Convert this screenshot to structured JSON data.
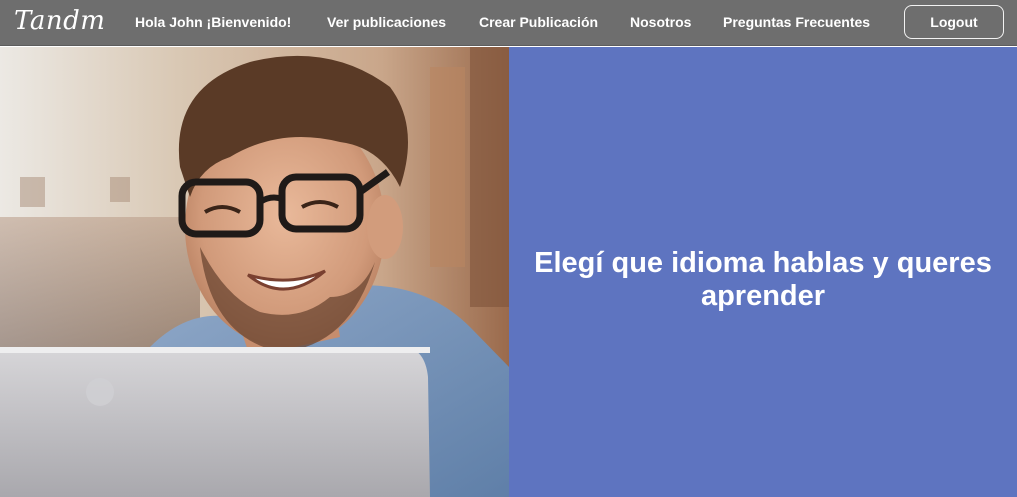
{
  "navbar": {
    "logo": "Tandm",
    "greeting": "Hola John ¡Bienvenido!",
    "links": {
      "posts": "Ver publicaciones",
      "create": "Crear Publicación",
      "about": "Nosotros",
      "faq": "Preguntas Frecuentes"
    },
    "logout_label": "Logout"
  },
  "hero": {
    "image_subject": "smiling man with glasses using laptop",
    "headline": "Elegí que idioma hablas y queres aprender"
  },
  "colors": {
    "navbar_bg": "#6e6e6e",
    "panel_bg": "#5e74c0",
    "text": "#ffffff"
  }
}
